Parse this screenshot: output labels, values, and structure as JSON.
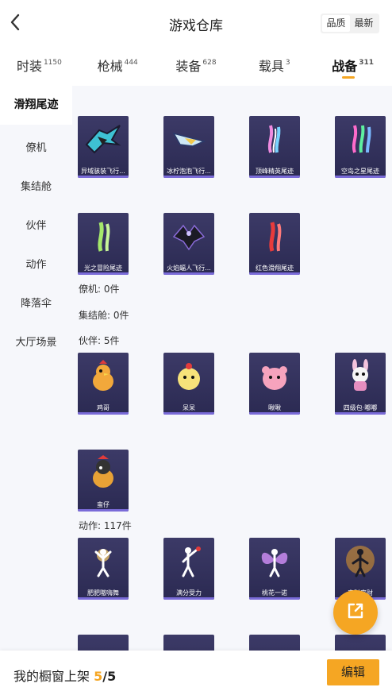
{
  "header": {
    "title": "游戏仓库",
    "sort_options": [
      "品质",
      "最新"
    ],
    "active_sort": "品质"
  },
  "tabs": [
    {
      "label": "时装",
      "count": "1150"
    },
    {
      "label": "枪械",
      "count": "444"
    },
    {
      "label": "装备",
      "count": "628"
    },
    {
      "label": "载具",
      "count": "3"
    },
    {
      "label": "战备",
      "count": "311"
    }
  ],
  "sidebar": {
    "items": [
      "滑翔尾迹",
      "僚机",
      "集结舱",
      "伙伴",
      "动作",
      "降落伞",
      "大厅场景"
    ],
    "active": "滑翔尾迹"
  },
  "sections": {
    "glide_items": [
      "异域骇装飞行...",
      "冰柠泡泡飞行...",
      "顶峰精英尾迹",
      "空岛之星尾迹",
      "光之冒险尾迹",
      "火焰蝠人飞行...",
      "红色滑翔尾迹"
    ],
    "wingman_label": "僚机: 0件",
    "pod_label": "集结舱: 0件",
    "partner_label": "伙伴: 5件",
    "partner_items": [
      "鸡哥",
      "呆呆",
      "啾啾",
      "四级包·嘟嘟",
      "蛮仔"
    ],
    "action_label": "动作: 117件",
    "action_items": [
      "肥肥嗷嗨舞",
      "满分受力",
      "桃花一诺",
      "来财来财"
    ]
  },
  "footer": {
    "showcase_label": "我的橱窗上架",
    "current": "5",
    "total": "/5",
    "edit_label": "编辑"
  },
  "colors": {
    "accent": "#f5a623",
    "card_bg": "#34325d",
    "sidebar_bg": "#f6f7fb"
  },
  "icons": [
    "back-arrow-icon",
    "share-icon"
  ]
}
